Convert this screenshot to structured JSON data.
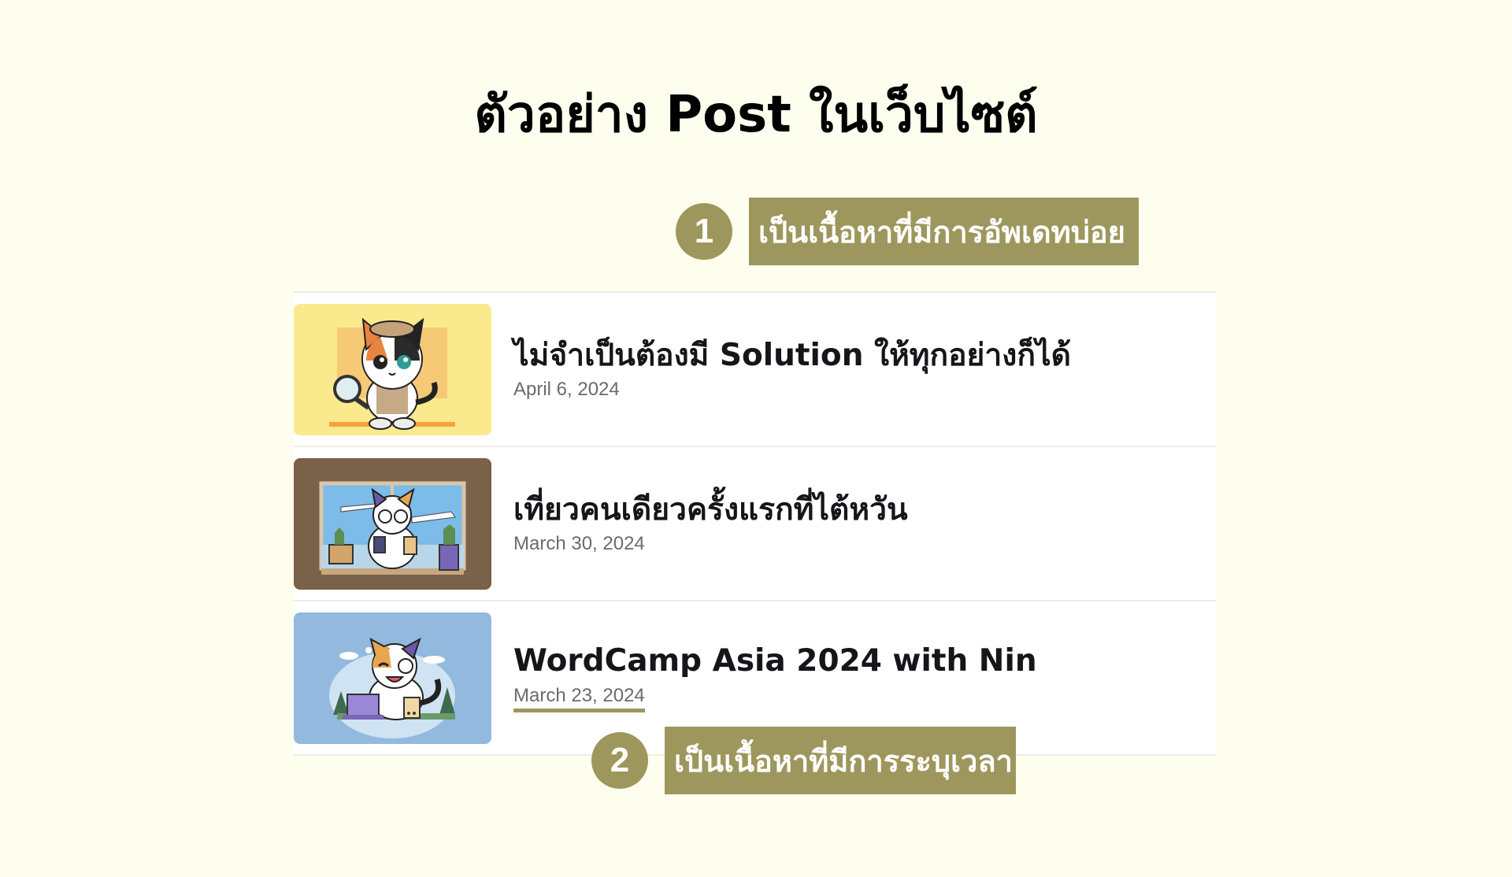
{
  "page": {
    "title": "ตัวอย่าง Post ในเว็บไซต์"
  },
  "callouts": [
    {
      "number": "1",
      "text": "เป็นเนื้อหาที่มีการอัพเดทบ่อย"
    },
    {
      "number": "2",
      "text": "เป็นเนื้อหาที่มีการระบุเวลา"
    }
  ],
  "posts": [
    {
      "title": "ไม่จำเป็นต้องมี Solution ให้ทุกอย่างก็ได้",
      "date": "April 6, 2024",
      "thumb_icon": "detective-cat-illustration",
      "thumb_color": "#fbe98d"
    },
    {
      "title": "เที่ยวคนเดียวครั้งแรกที่ไต้หวัน",
      "date": "March 30, 2024",
      "thumb_icon": "traveling-cat-illustration",
      "thumb_color": "#7a6149"
    },
    {
      "title": "WordCamp Asia 2024 with Nin",
      "date": "March 23, 2024",
      "thumb_icon": "laptop-cat-illustration",
      "thumb_color": "#93b9de"
    }
  ],
  "colors": {
    "background": "#fefeee",
    "accent": "#9e975d",
    "card": "#ffffff"
  }
}
